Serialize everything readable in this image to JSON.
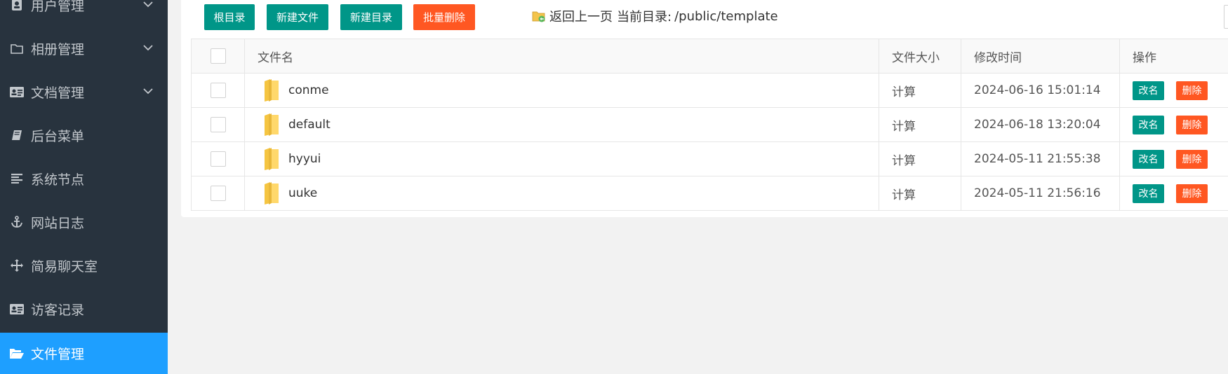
{
  "sidebar": {
    "items": [
      {
        "label": "用户管理",
        "icon": "user-lock-icon",
        "expandable": true
      },
      {
        "label": "相册管理",
        "icon": "folder-outline-icon",
        "expandable": true
      },
      {
        "label": "文档管理",
        "icon": "id-card-icon",
        "expandable": true
      },
      {
        "label": "后台菜单",
        "icon": "book-icon",
        "expandable": false
      },
      {
        "label": "系统节点",
        "icon": "align-left-icon",
        "expandable": false
      },
      {
        "label": "网站日志",
        "icon": "anchor-icon",
        "expandable": false
      },
      {
        "label": "简易聊天室",
        "icon": "move-arrows-icon",
        "expandable": false
      },
      {
        "label": "访客记录",
        "icon": "id-card-icon",
        "expandable": false
      },
      {
        "label": "文件管理",
        "icon": "folder-open-icon",
        "expandable": false,
        "active": true
      }
    ]
  },
  "toolbar": {
    "root_dir": "根目录",
    "new_file": "新建文件",
    "new_dir": "新建目录",
    "batch_delete": "批量删除",
    "back": "返回上一页",
    "current_dir_label": "当前目录:",
    "current_path": "/public/template"
  },
  "table": {
    "headers": {
      "name": "文件名",
      "size": "文件大小",
      "modified": "修改时间",
      "actions": "操作"
    },
    "rows": [
      {
        "name": "conme",
        "size": "计算",
        "modified": "2024-06-16 15:01:14"
      },
      {
        "name": "default",
        "size": "计算",
        "modified": "2024-06-18 13:20:04"
      },
      {
        "name": "hyyui",
        "size": "计算",
        "modified": "2024-05-11 21:55:38"
      },
      {
        "name": "uuke",
        "size": "计算",
        "modified": "2024-05-11 21:56:16"
      }
    ],
    "rename_label": "改名",
    "delete_label": "删除"
  },
  "colors": {
    "sidebar_bg": "#28333e",
    "active_item": "#1e9fff",
    "green": "#009688",
    "red": "#ff5722"
  }
}
